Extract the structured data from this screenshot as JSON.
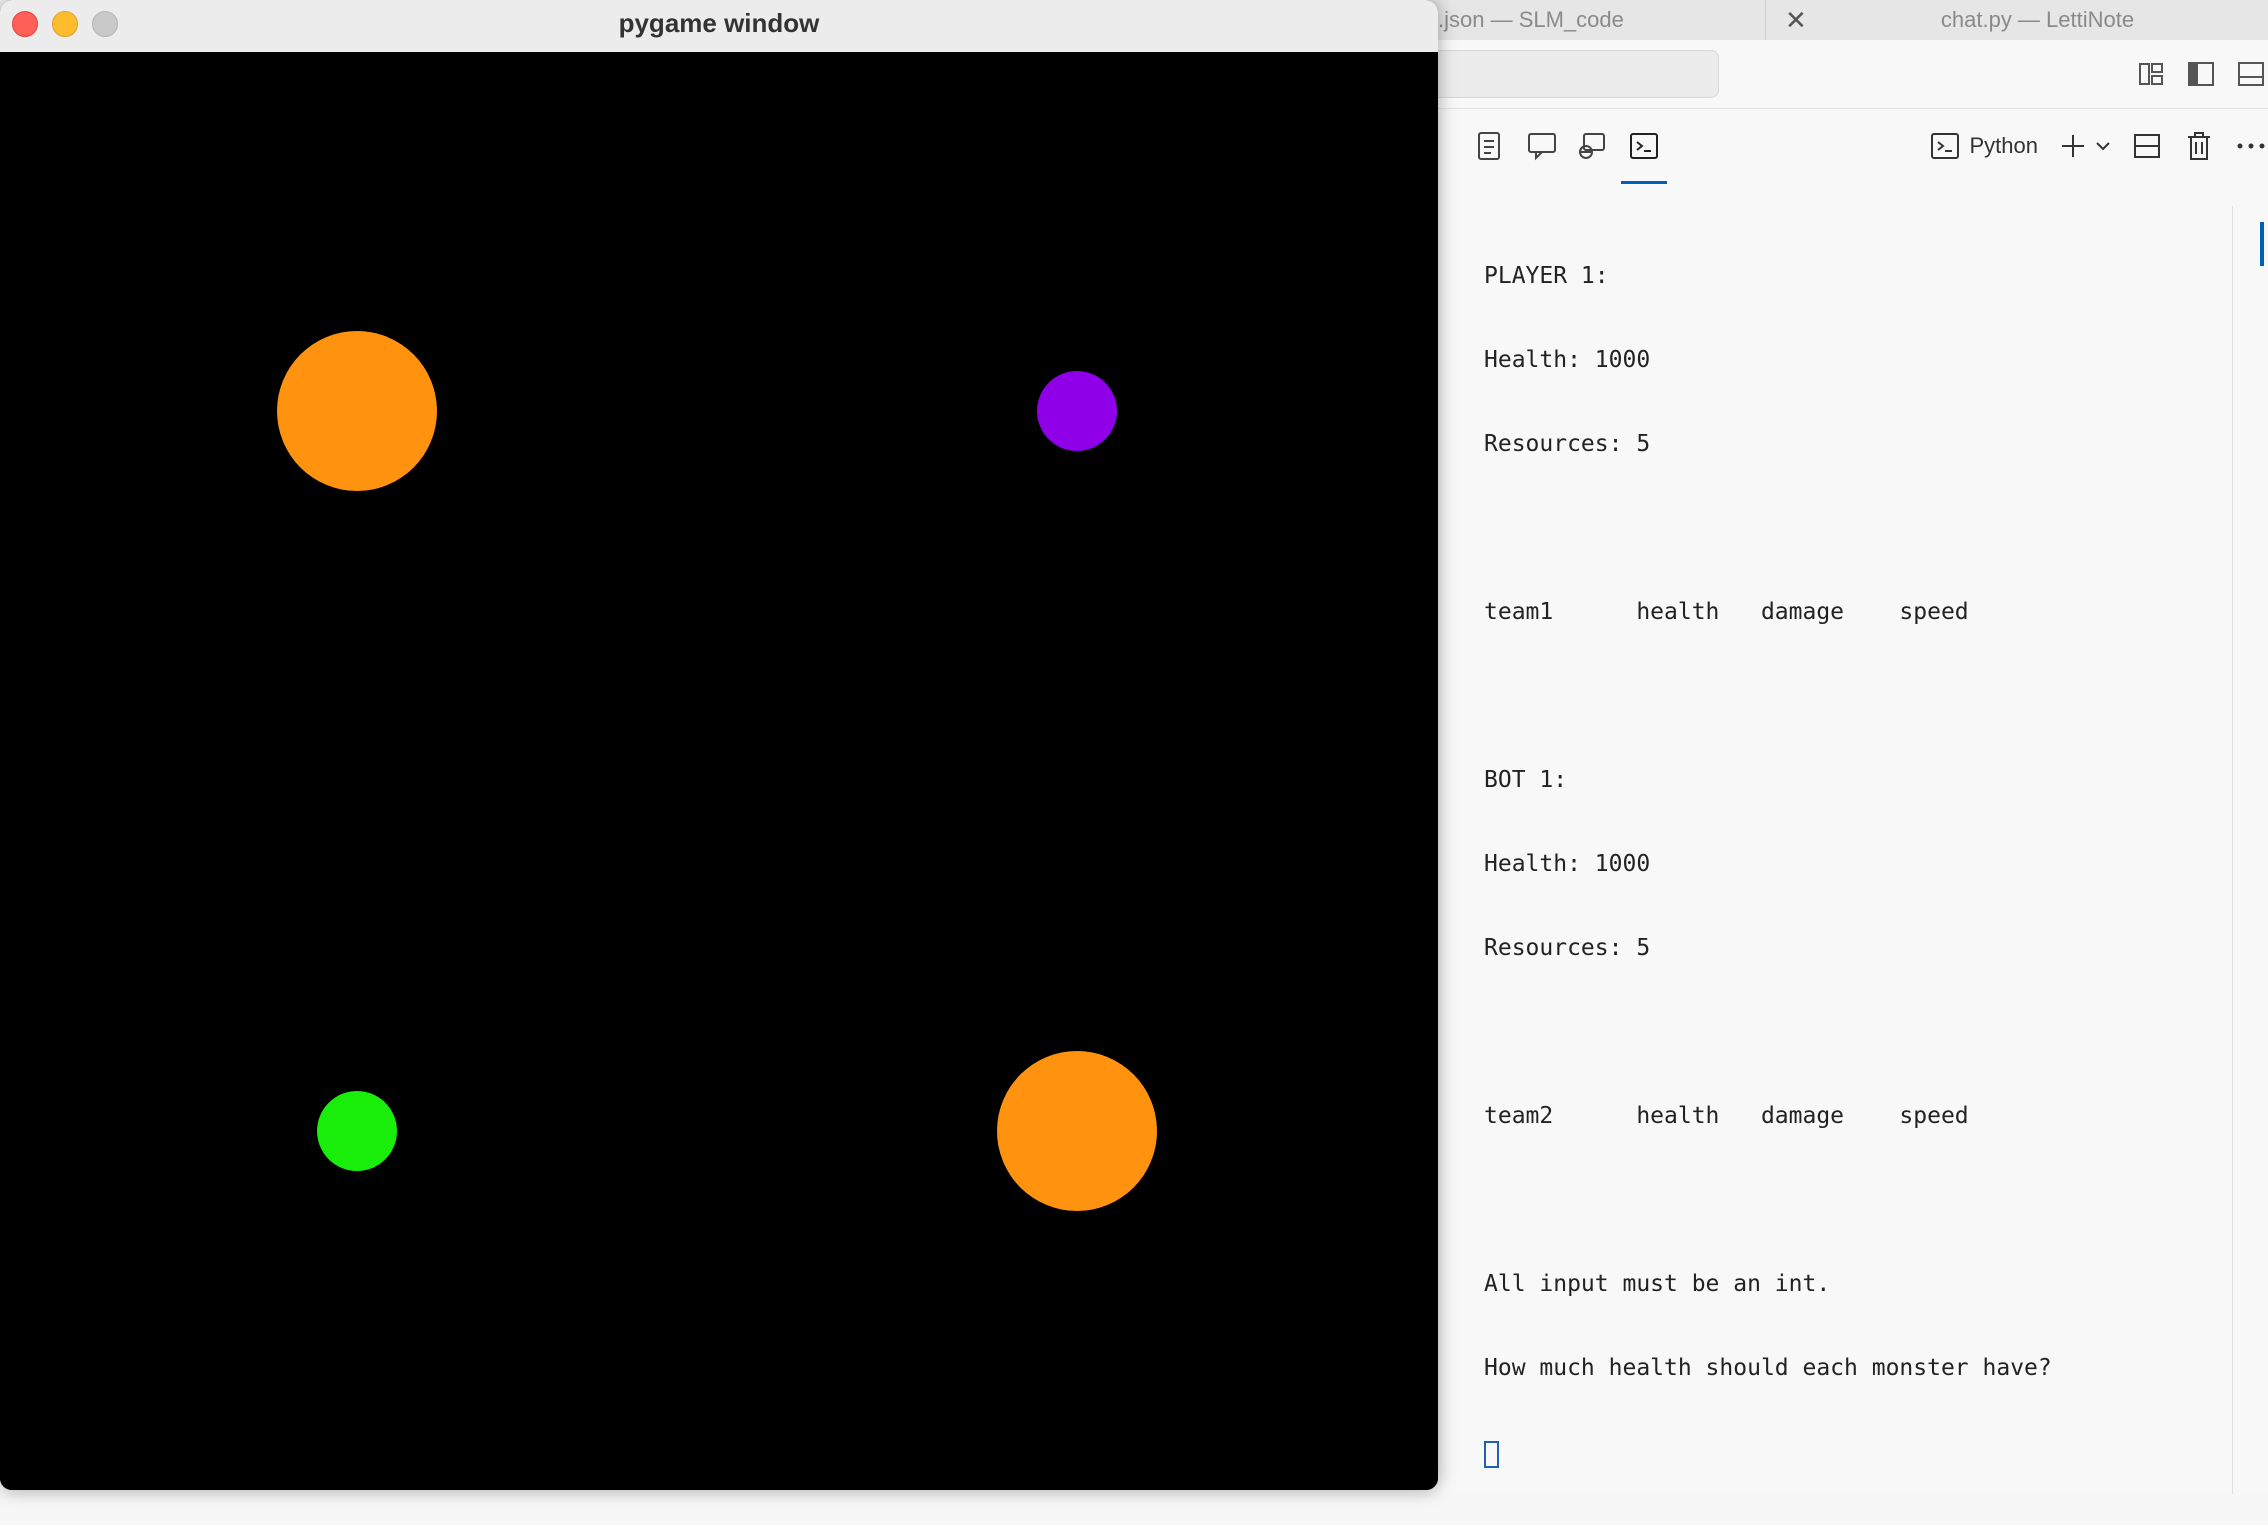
{
  "vscode": {
    "tabs": [
      {
        "label": ".json — SLM_code"
      },
      {
        "label": "chat.py — LettiNote"
      }
    ],
    "terminal_profile": "Python",
    "terminal_lines": [
      "PLAYER 1:",
      "Health: 1000",
      "Resources: 5",
      "",
      "team1      health   damage    speed",
      "",
      "BOT 1:",
      "Health: 1000",
      "Resources: 5",
      "",
      "team2      health   damage    speed",
      "",
      "All input must be an int.",
      "How much health should each monster have?"
    ]
  },
  "pygame": {
    "title": "pygame window",
    "circles": [
      {
        "name": "orange-circle-top-left",
        "color": "#ff930f"
      },
      {
        "name": "purple-circle-top-right",
        "color": "#8f00e8"
      },
      {
        "name": "green-circle-bottom-left",
        "color": "#19ee0a"
      },
      {
        "name": "orange-circle-bottom-right",
        "color": "#ff930f"
      }
    ]
  },
  "colors": {
    "accent": "#005fb8",
    "orange": "#ff930f",
    "purple": "#8f00e8",
    "green": "#19ee0a"
  }
}
